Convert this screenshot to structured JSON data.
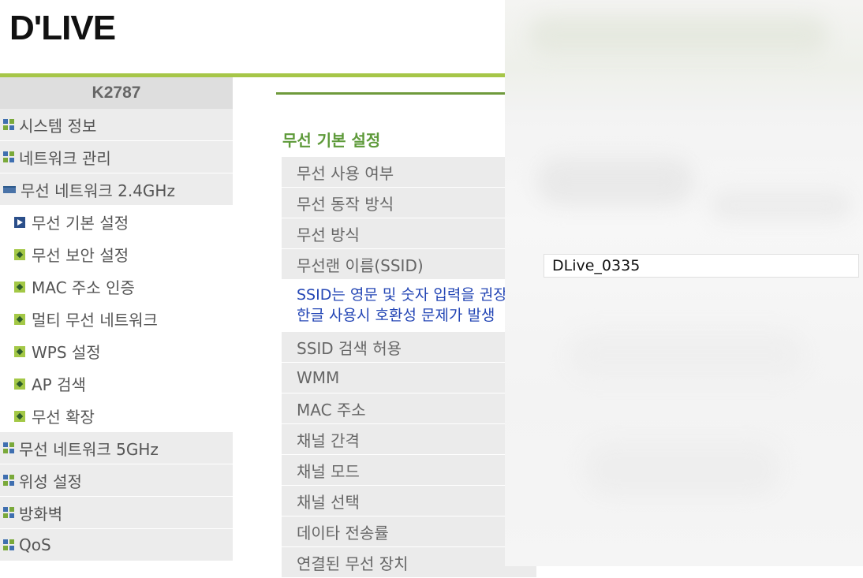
{
  "logo": "D'LIVE",
  "sidebar": {
    "model": "K2787",
    "items": [
      {
        "label": "시스템 정보",
        "type": "top",
        "icon": "grid-icon"
      },
      {
        "label": "네트워크 관리",
        "type": "top",
        "icon": "grid-icon"
      },
      {
        "label": "무선 네트워크 2.4GHz",
        "type": "top",
        "icon": "expanded-menu-icon"
      },
      {
        "label": "무선 기본 설정",
        "type": "sub",
        "icon": "active-arrow-icon"
      },
      {
        "label": "무선 보안 설정",
        "type": "sub",
        "icon": "bullet-icon"
      },
      {
        "label": "MAC 주소 인증",
        "type": "sub",
        "icon": "bullet-icon"
      },
      {
        "label": "멀티 무선 네트워크",
        "type": "sub",
        "icon": "bullet-icon"
      },
      {
        "label": "WPS 설정",
        "type": "sub",
        "icon": "bullet-icon"
      },
      {
        "label": "AP 검색",
        "type": "sub",
        "icon": "bullet-icon"
      },
      {
        "label": "무선 확장",
        "type": "sub",
        "icon": "bullet-icon"
      },
      {
        "label": "무선 네트워크 5GHz",
        "type": "top",
        "icon": "grid-icon"
      },
      {
        "label": "위성 설정",
        "type": "top",
        "icon": "grid-icon"
      },
      {
        "label": "방화벽",
        "type": "top",
        "icon": "grid-icon"
      },
      {
        "label": "QoS",
        "type": "top",
        "icon": "grid-icon"
      }
    ]
  },
  "main": {
    "section_title": "무선 기본 설정",
    "rows_before": [
      "무선 사용 여부",
      "무선 동작 방식",
      "무선 방식",
      "무선랜 이름(SSID)"
    ],
    "note_line1": "SSID는 영문 및 숫자 입력을 권장",
    "note_line2": "한글 사용시 호환성 문제가 발생",
    "rows_after": [
      "SSID 검색 허용",
      "WMM",
      "MAC 주소",
      "채널 간격",
      "채널 모드",
      "채널 선택",
      "데이타 전송률",
      "연결된 무선 장치"
    ],
    "ssid_value": "DLive_0335"
  },
  "colors": {
    "accent_green": "#a6c648",
    "section_green": "#5e9a3a",
    "note_blue": "#2446b5",
    "row_bg": "#ebebeb"
  }
}
